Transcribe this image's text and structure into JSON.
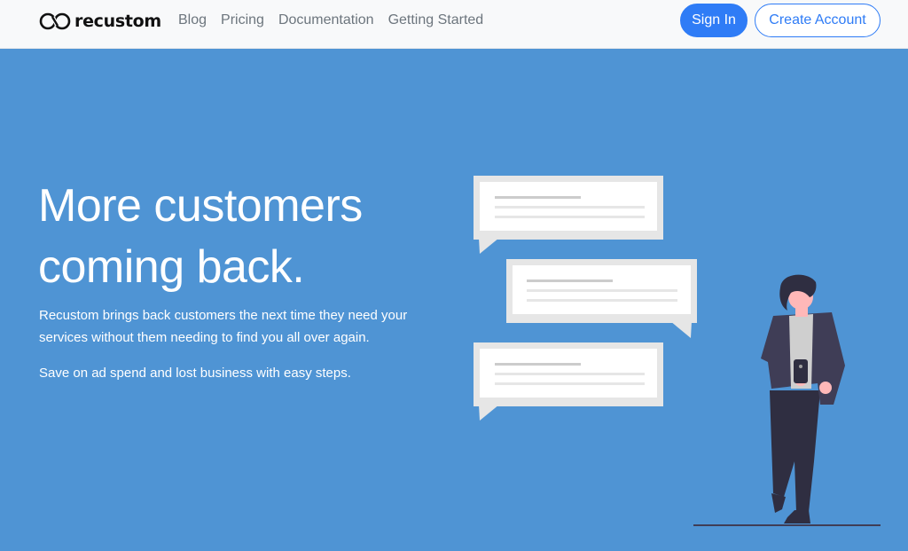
{
  "brand": {
    "name": "recustom"
  },
  "nav": {
    "links": [
      "Blog",
      "Pricing",
      "Documentation",
      "Getting Started"
    ],
    "sign_in": "Sign In",
    "create_account": "Create Account"
  },
  "hero": {
    "title": "More customers coming back.",
    "paragraph_1": "Recustom brings back customers the next time they need your services without them needing to find you all over again.",
    "paragraph_2": "Save on ad spend and lost business with easy steps."
  },
  "colors": {
    "background": "#4f94d4",
    "navbar": "#f8f9fa",
    "accent": "#2f7cf6",
    "jacket": "#3f3d56",
    "pants": "#2f2e41",
    "skin": "#ffb8b8"
  },
  "icons": [
    "recustom-logo-icon",
    "phone-icon"
  ]
}
